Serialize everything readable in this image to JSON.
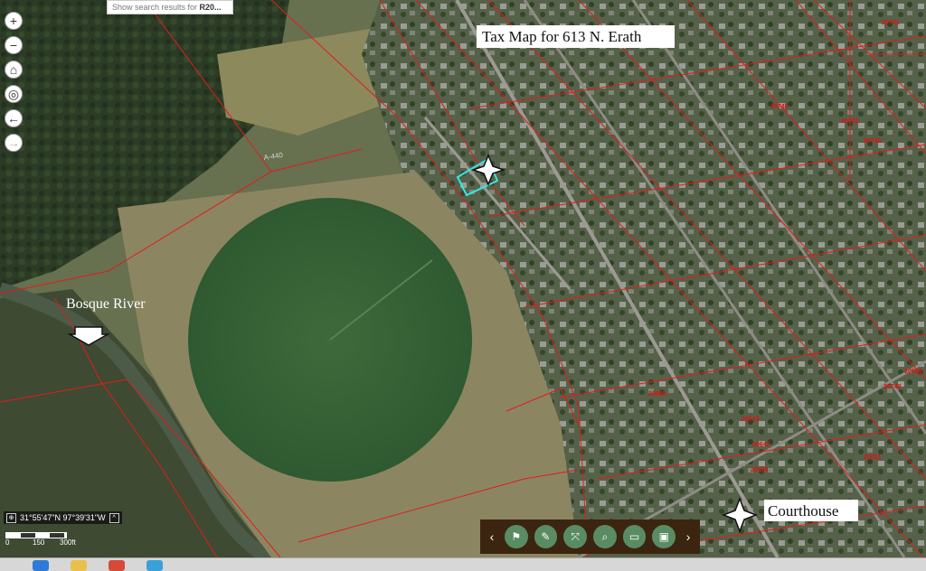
{
  "map": {
    "title": "Tax Map for 613 N. Erath",
    "search_hint_prefix": "Show search results for ",
    "search_hint_term": "R20...",
    "road_label": "A-440",
    "river_label": "Bosque River",
    "courthouse_label": "Courthouse",
    "coordinates": "31°55'47\"N 97°39'31\"W",
    "scale": {
      "zero": "0",
      "mid": "150",
      "end": "300ft"
    },
    "parcel_numbers": [
      "20746",
      "20741",
      "20740",
      "20748",
      "20742",
      "20643",
      "20642",
      "20658",
      "20694",
      "20651",
      "20630"
    ]
  },
  "zoom_controls": [
    {
      "name": "zoom-in-button",
      "glyph": "+",
      "interactable": true
    },
    {
      "name": "zoom-out-button",
      "glyph": "−",
      "interactable": true
    },
    {
      "name": "home-button",
      "glyph": "⌂",
      "interactable": true
    },
    {
      "name": "locate-button",
      "glyph": "◎",
      "interactable": true
    },
    {
      "name": "back-button",
      "glyph": "←",
      "interactable": true
    },
    {
      "name": "forward-button",
      "glyph": "→",
      "interactable": false
    }
  ],
  "toolbar": {
    "prev": "‹",
    "next": "›",
    "buttons": [
      {
        "name": "bookmark-tool-button",
        "icon": "bookmark-icon",
        "glyph": "⚑"
      },
      {
        "name": "draw-tool-button",
        "icon": "pencil-icon",
        "glyph": "✎"
      },
      {
        "name": "measure-tool-button",
        "icon": "measure-icon",
        "glyph": "⤧"
      },
      {
        "name": "query-tool-button",
        "icon": "zoom-search-icon",
        "glyph": "⌕"
      },
      {
        "name": "basemap-tool-button",
        "icon": "basemap-icon",
        "glyph": "▭"
      },
      {
        "name": "print-tool-button",
        "icon": "print-icon",
        "glyph": "▣"
      }
    ]
  },
  "colors": {
    "parcel_line": "#e21c1c",
    "selected_parcel": "#35e6e6",
    "pivot_field": "#3f6b3a",
    "toolbar_bg": "#3b2510",
    "toolbar_button": "#5a8c63"
  }
}
